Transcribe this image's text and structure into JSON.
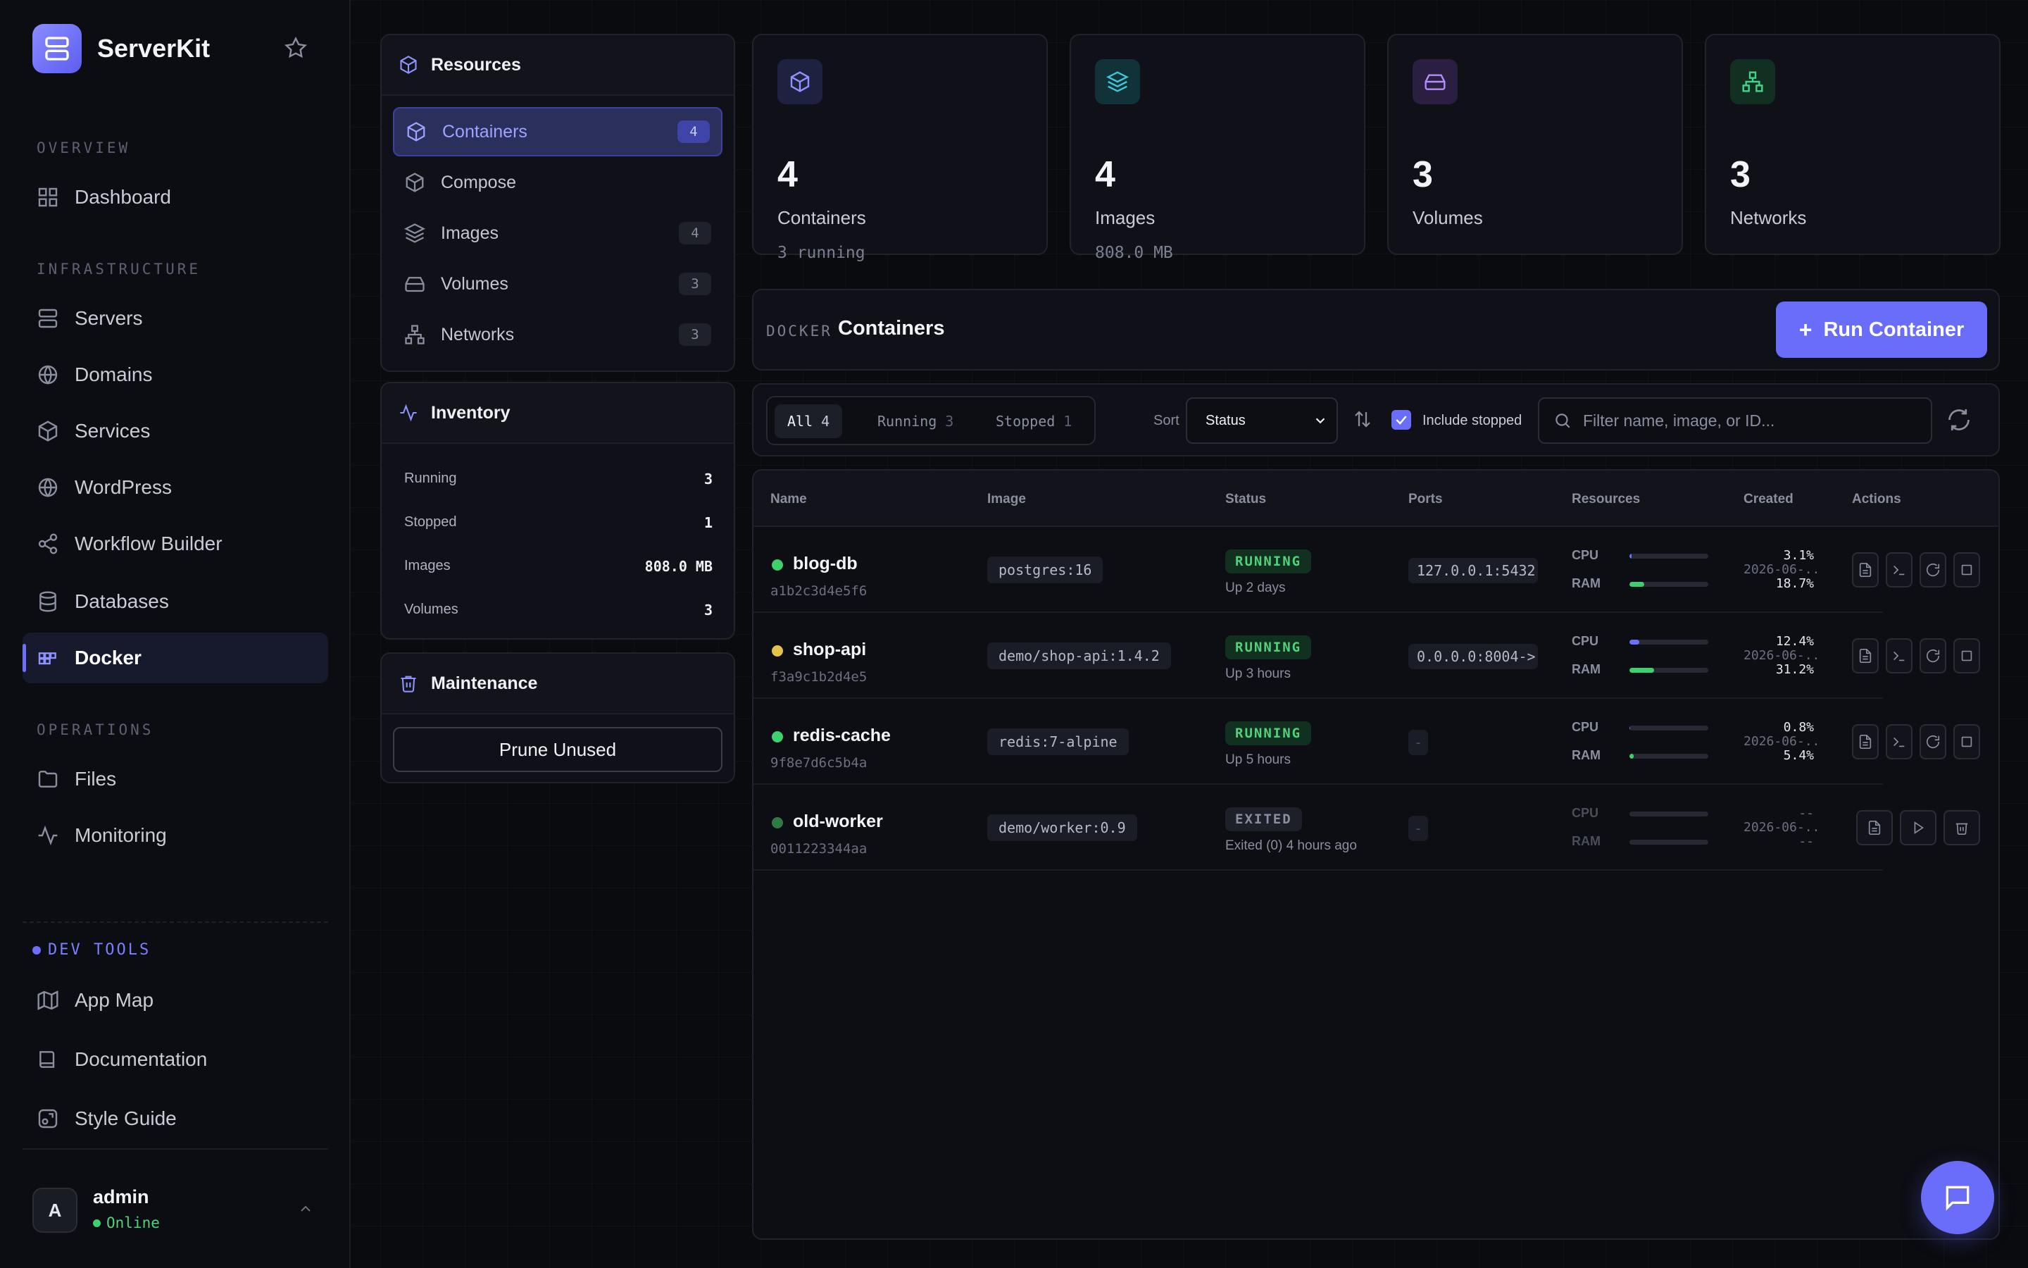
{
  "brand": {
    "name": "ServerKit"
  },
  "sidebar": {
    "sections": {
      "overview": "OVERVIEW",
      "infrastructure": "INFRASTRUCTURE",
      "operations": "OPERATIONS",
      "devtools": "DEV TOOLS"
    },
    "items": {
      "dashboard": "Dashboard",
      "servers": "Servers",
      "domains": "Domains",
      "services": "Services",
      "wordpress": "WordPress",
      "workflow": "Workflow Builder",
      "databases": "Databases",
      "docker": "Docker",
      "files": "Files",
      "monitoring": "Monitoring",
      "appmap": "App Map",
      "docs": "Documentation",
      "styleguide": "Style Guide"
    },
    "active": "docker"
  },
  "user": {
    "initial": "A",
    "name": "admin",
    "status": "Online"
  },
  "resources": {
    "title": "Resources",
    "items": [
      {
        "label": "Containers",
        "count": "4"
      },
      {
        "label": "Compose",
        "count": ""
      },
      {
        "label": "Images",
        "count": "4"
      },
      {
        "label": "Volumes",
        "count": "3"
      },
      {
        "label": "Networks",
        "count": "3"
      }
    ]
  },
  "inventory": {
    "title": "Inventory",
    "rows": [
      {
        "label": "Running",
        "value": "3"
      },
      {
        "label": "Stopped",
        "value": "1"
      },
      {
        "label": "Images",
        "value": "808.0 MB"
      },
      {
        "label": "Volumes",
        "value": "3"
      }
    ]
  },
  "maintenance": {
    "title": "Maintenance",
    "prune_label": "Prune Unused"
  },
  "stats": [
    {
      "value": "4",
      "label": "Containers",
      "sub": "3 running",
      "color": "#8f92ff"
    },
    {
      "value": "4",
      "label": "Images",
      "sub": "808.0 MB",
      "color": "#3fc6d9"
    },
    {
      "value": "3",
      "label": "Volumes",
      "sub": "",
      "color": "#b48cff"
    },
    {
      "value": "3",
      "label": "Networks",
      "sub": "",
      "color": "#45d38a"
    }
  ],
  "header": {
    "eyebrow": "DOCKER",
    "title": "Containers",
    "run_label": "Run Container"
  },
  "toolbar": {
    "filters": [
      {
        "label": "All",
        "count": "4"
      },
      {
        "label": "Running",
        "count": "3"
      },
      {
        "label": "Stopped",
        "count": "1"
      }
    ],
    "sort_label": "Sort",
    "sort_value": "Status",
    "include_stopped": "Include stopped",
    "search_placeholder": "Filter name, image, or ID..."
  },
  "table": {
    "columns": {
      "name": "Name",
      "image": "Image",
      "status": "Status",
      "ports": "Ports",
      "resources": "Resources",
      "created": "Created",
      "actions": "Actions"
    },
    "cpu_label": "CPU",
    "ram_label": "RAM",
    "rows": [
      {
        "name": "blog-db",
        "id": "a1b2c3d4e5f6",
        "image": "postgres:16",
        "status": "RUNNING",
        "uptime": "Up 2 days",
        "ports": "127.0.0.1:5432",
        "cpu": "3.1%",
        "ram": "18.7%",
        "cpu_frac": 0.031,
        "ram_frac": 0.187,
        "created": "2026-06-...",
        "dot": "#3ecf6e"
      },
      {
        "name": "shop-api",
        "id": "f3a9c1b2d4e5",
        "image": "demo/shop-api:1.4.2",
        "status": "RUNNING",
        "uptime": "Up 3 hours",
        "ports": "0.0.0.0:8004->",
        "cpu": "12.4%",
        "ram": "31.2%",
        "cpu_frac": 0.124,
        "ram_frac": 0.312,
        "created": "2026-06-...",
        "dot": "#e5c34a"
      },
      {
        "name": "redis-cache",
        "id": "9f8e7d6c5b4a",
        "image": "redis:7-alpine",
        "status": "RUNNING",
        "uptime": "Up 5 hours",
        "ports": "-",
        "cpu": "0.8%",
        "ram": "5.4%",
        "cpu_frac": 0.008,
        "ram_frac": 0.054,
        "created": "2026-06-...",
        "dot": "#3ecf6e"
      },
      {
        "name": "old-worker",
        "id": "0011223344aa",
        "image": "demo/worker:0.9",
        "status": "EXITED",
        "uptime": "Exited (0) 4 hours ago",
        "ports": "-",
        "cpu": "--",
        "ram": "--",
        "cpu_frac": 0,
        "ram_frac": 0,
        "created": "2026-06-...",
        "dot": "#2f7a45"
      }
    ]
  },
  "colors": {
    "accent": "#6a6dfa",
    "running": "#4fd27a",
    "cpu_bar": "#6d70ff",
    "ram_bar": "#3ecf6e"
  }
}
